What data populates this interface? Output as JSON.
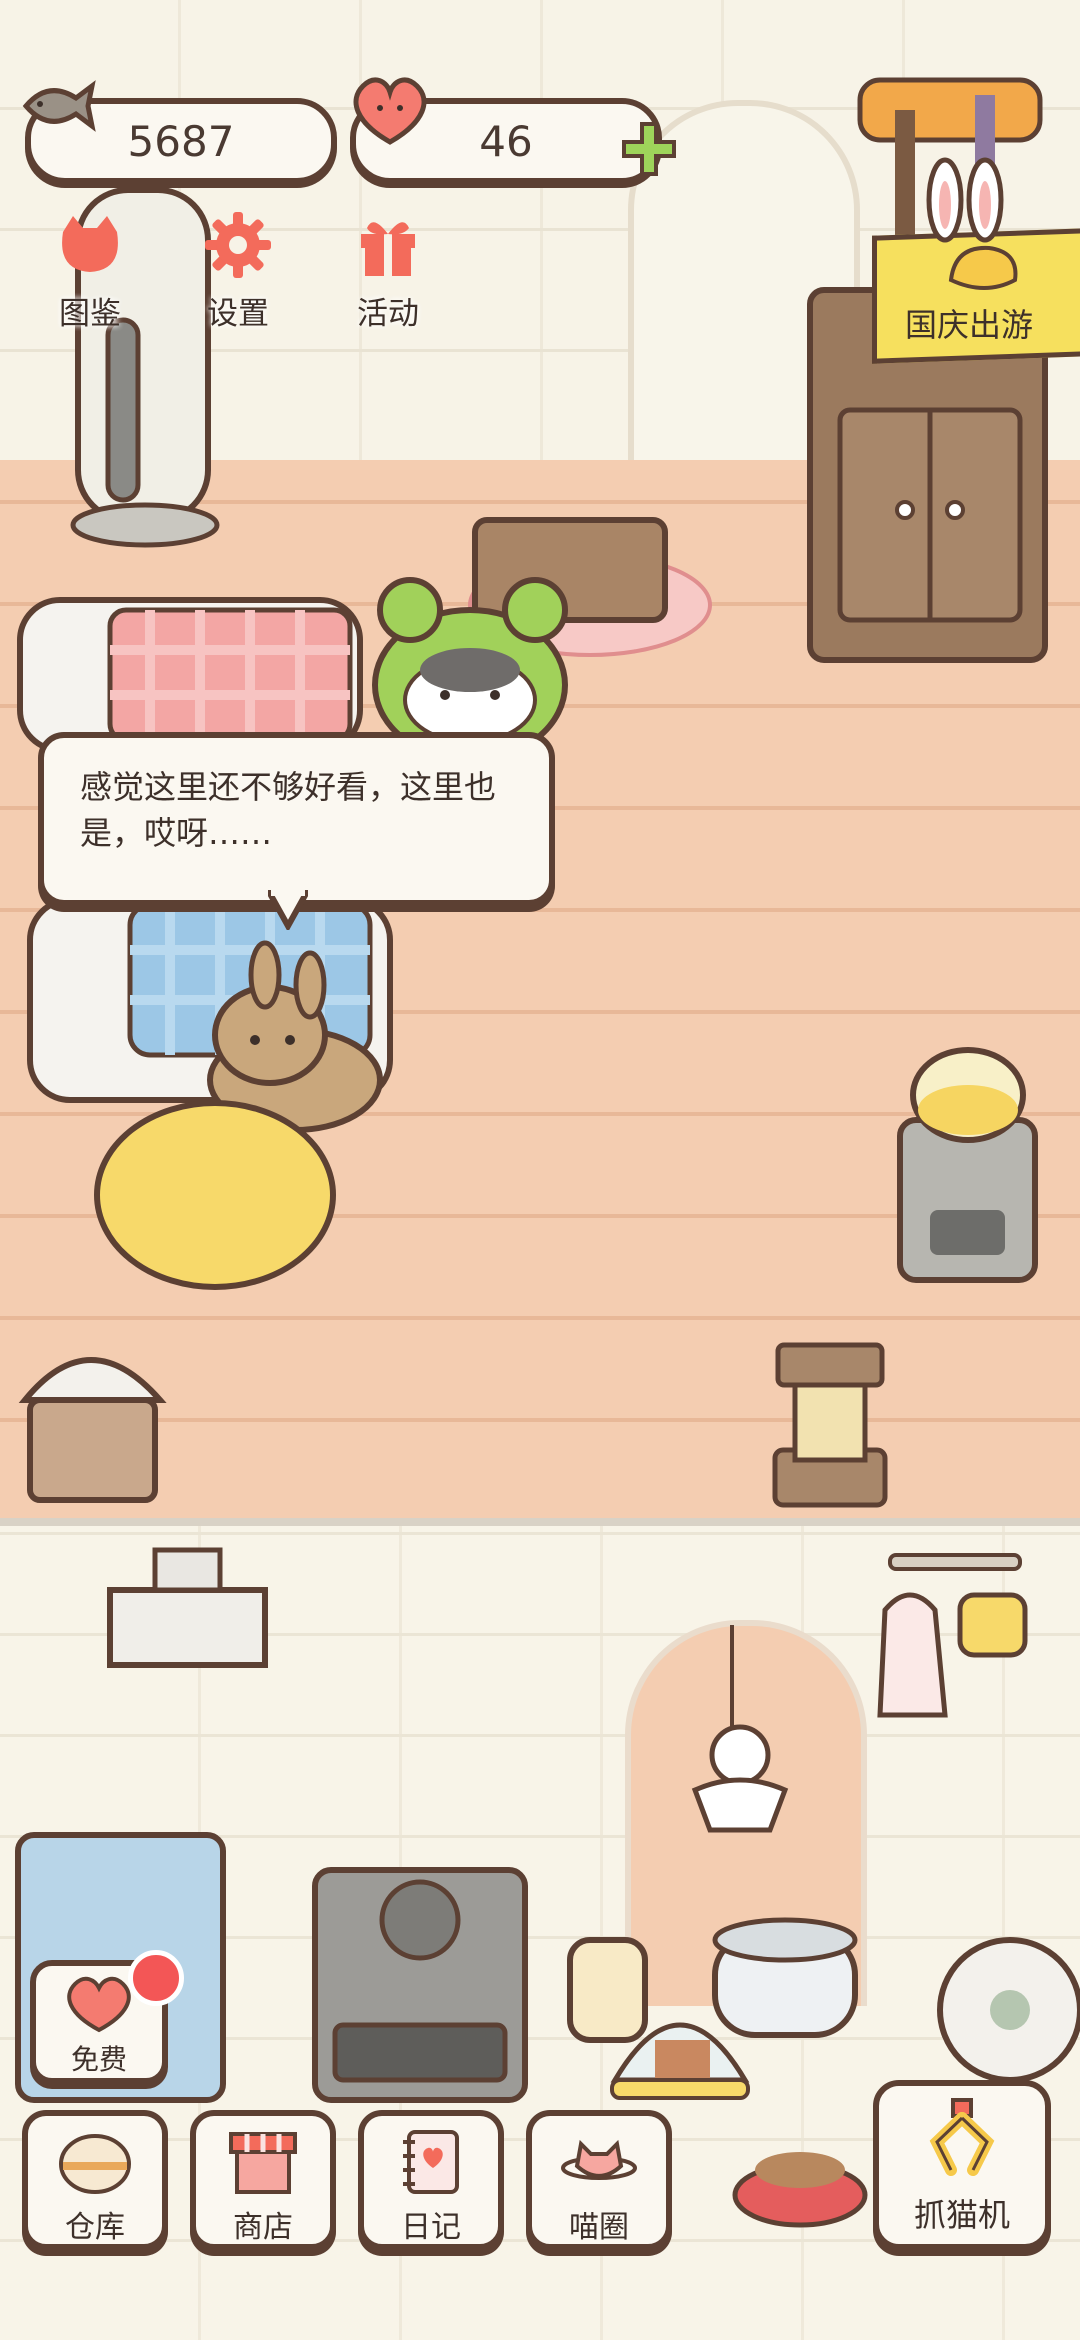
{
  "currency": {
    "fish": "5687",
    "hearts": "46"
  },
  "top_menu": [
    {
      "label": "图鉴",
      "icon": "cat-face-icon"
    },
    {
      "label": "设置",
      "icon": "gear-icon"
    },
    {
      "label": "活动",
      "icon": "gift-icon"
    }
  ],
  "event": {
    "label": "国庆出游"
  },
  "speech": {
    "text": "感觉这里还不够好看，这里也是，哎呀……"
  },
  "free_button": {
    "label": "免费"
  },
  "bottom_bar": [
    {
      "label": "仓库",
      "icon": "storage-icon"
    },
    {
      "label": "商店",
      "icon": "shop-icon"
    },
    {
      "label": "日记",
      "icon": "diary-icon"
    },
    {
      "label": "喵圈",
      "icon": "cat-planet-icon"
    }
  ],
  "claw_machine": {
    "label": "抓猫机"
  },
  "colors": {
    "outline": "#5c4033",
    "floor": "#f4cdb1",
    "accent_red": "#f36b5b",
    "accent_green": "#9ed45a",
    "event_yellow": "#f6e05e"
  }
}
